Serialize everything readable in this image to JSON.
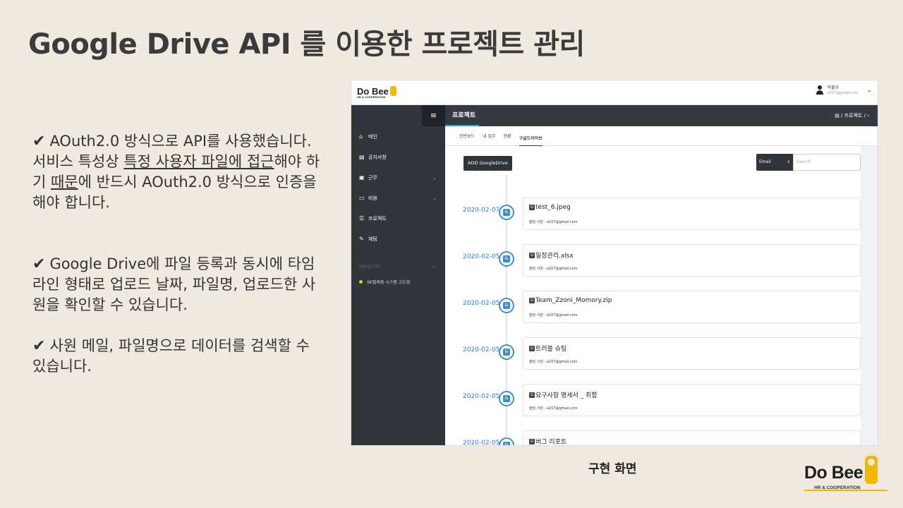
{
  "slide": {
    "title": "Google Drive API 를 이용한 프로젝트 관리",
    "caption": "구현 화면",
    "logo_text": "Do Bee",
    "logo_sub": "HR & COOPERATION"
  },
  "bullets": [
    {
      "part1": "AOuth2.0 방식으로 API를 사용했습니다. 서비스 특성상 ",
      "u1": "특정 사용자 파일에 접근",
      "part2": "해야 하기 ",
      "u2": "때문",
      "part3": "에 반드시 AOuth2.0 방식으로 인증을 해야 합니다."
    },
    {
      "text": "Google Drive에 파일 등록과 동시에 타임라인 형태로 업로드 날짜, 파일명, 업로드한 사원을 확인할 수 있습니다."
    },
    {
      "text": "사원 메일, 파일명으로 데이터를 검색할 수 있습니다."
    }
  ],
  "app": {
    "logo": "Do Bee",
    "logo_sub": "HR & COOPERATION",
    "user_name": "아힐수",
    "user_email": "a157@gmail.com",
    "header_title": "프로젝트",
    "breadcrumb": "/ 프로젝트 /",
    "sidebar": [
      {
        "label": "메인",
        "icon": "home-icon",
        "glyph": "⌂"
      },
      {
        "label": "공지사항",
        "icon": "document-icon",
        "glyph": "▤"
      },
      {
        "label": "근무",
        "icon": "briefcase-icon",
        "glyph": "▣",
        "caret": "⌄"
      },
      {
        "label": "비용",
        "icon": "card-icon",
        "glyph": "▭",
        "caret": "⌄"
      },
      {
        "label": "프로젝트",
        "icon": "list-icon",
        "glyph": "☰"
      },
      {
        "label": "채팅",
        "icon": "chat-icon",
        "glyph": "✎"
      }
    ],
    "projects_section": "PROJECTS",
    "projects_close": "×",
    "project_item": "SK텔레콤 시스템 고도화",
    "tabs": [
      "칸반보드",
      "내 업무",
      "현황",
      "구글드라이브"
    ],
    "add_button": "ADD GoogleDrive",
    "search_select": "Email",
    "search_placeholder": "Search",
    "timeline": [
      {
        "date": "2020-02-07",
        "file": "test_6.jpeg",
        "uploader": "올린 사원 : a157@gmail.com"
      },
      {
        "date": "2020-02-05",
        "file": "일정관리.xlsx",
        "uploader": "올린 사원 : a157@gmail.com"
      },
      {
        "date": "2020-02-05",
        "file": "Team_Zzoni_Momory.zip",
        "uploader": "올린 사원 : a157@gmail.com"
      },
      {
        "date": "2020-02-05",
        "file": "트러블 슈팅",
        "uploader": "올린 사원 : a157@gmail.com"
      },
      {
        "date": "2020-02-05",
        "file": "요구사항 명세서 _ 취합",
        "uploader": "올린 사원 : a157@gmail.com"
      },
      {
        "date": "2020-02-05",
        "file": "버그 리포트",
        "uploader": ""
      }
    ]
  }
}
